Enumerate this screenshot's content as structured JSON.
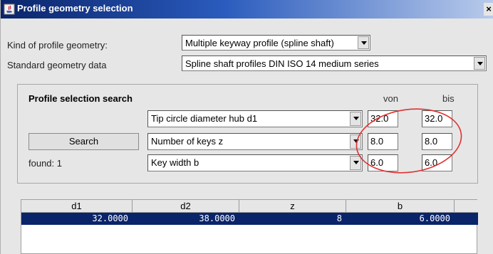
{
  "window": {
    "title": "Profile geometry selection",
    "close_label": "×"
  },
  "form": {
    "kind_label": "Kind of profile geometry:",
    "kind_value": "Multiple keyway profile (spline shaft)",
    "standard_label": "Standard geometry data",
    "standard_value": "Spline shaft profiles DIN ISO 14 medium series"
  },
  "search_panel": {
    "title": "Profile selection search",
    "col_from": "von",
    "col_to": "bis",
    "search_button": "Search",
    "found_text": "found: 1",
    "criteria": [
      {
        "param": "Tip circle diameter hub d1",
        "from": "32.0",
        "to": "32.0"
      },
      {
        "param": "Number of keys z",
        "from": "8.0",
        "to": "8.0"
      },
      {
        "param": "Key width b",
        "from": "6.0",
        "to": "6.0"
      }
    ]
  },
  "results_table": {
    "columns": [
      "d1",
      "d2",
      "z",
      "b"
    ],
    "rows": [
      [
        "32.0000",
        "38.0000",
        "8",
        "6.0000"
      ]
    ]
  },
  "colors": {
    "title_bar": "#0a246a",
    "selected_row": "#0a246a",
    "annotation": "#e03030"
  }
}
